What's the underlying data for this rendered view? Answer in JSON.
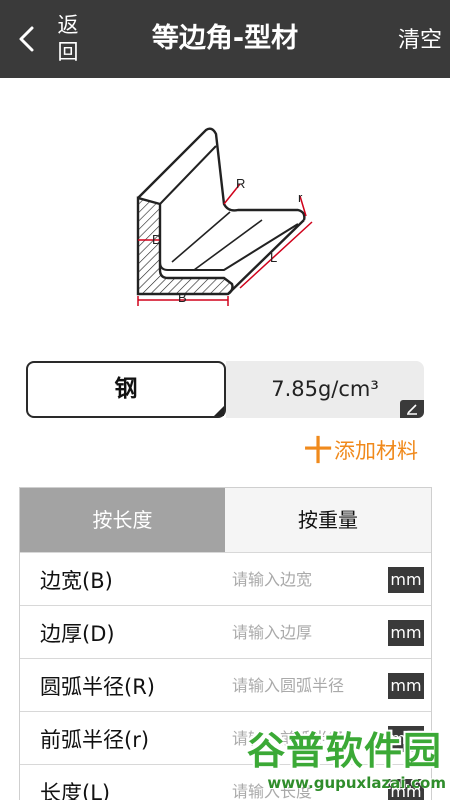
{
  "header": {
    "back_label": "返回",
    "title": "等边角-型材",
    "clear_label": "清空"
  },
  "diagram": {
    "labels": {
      "R": "R",
      "r": "r",
      "D": "D",
      "L": "L",
      "B": "B"
    },
    "stroke_color": "#222222",
    "dimension_color": "#d0021b"
  },
  "material": {
    "name": "钢",
    "density": "7.85g/cm³"
  },
  "add_material": {
    "icon": "plus-icon",
    "icon_glyph": "十",
    "label": "添加材料",
    "color": "#f08a1c"
  },
  "tabs": [
    {
      "label": "按长度",
      "active": true
    },
    {
      "label": "按重量",
      "active": false
    }
  ],
  "fields": [
    {
      "label": "边宽(B)",
      "placeholder": "请输入边宽",
      "value": "",
      "unit": "mm"
    },
    {
      "label": "边厚(D)",
      "placeholder": "请输入边厚",
      "value": "",
      "unit": "mm"
    },
    {
      "label": "圆弧半径(R)",
      "placeholder": "请输入圆弧半径",
      "value": "",
      "unit": "mm"
    },
    {
      "label": "前弧半径(r)",
      "placeholder": "请输入前弧半径",
      "value": "",
      "unit": "mm"
    },
    {
      "label": "长度(L)",
      "placeholder": "请输入长度",
      "value": "",
      "unit": "mm"
    }
  ],
  "watermark": {
    "main": "谷普软件园",
    "sub": "www.gupuxlazai.com"
  },
  "colors": {
    "topbar": "#3a3a3a",
    "accent": "#f08a1c",
    "tab_active": "#a3a3a3",
    "watermark": "#3ba936"
  }
}
